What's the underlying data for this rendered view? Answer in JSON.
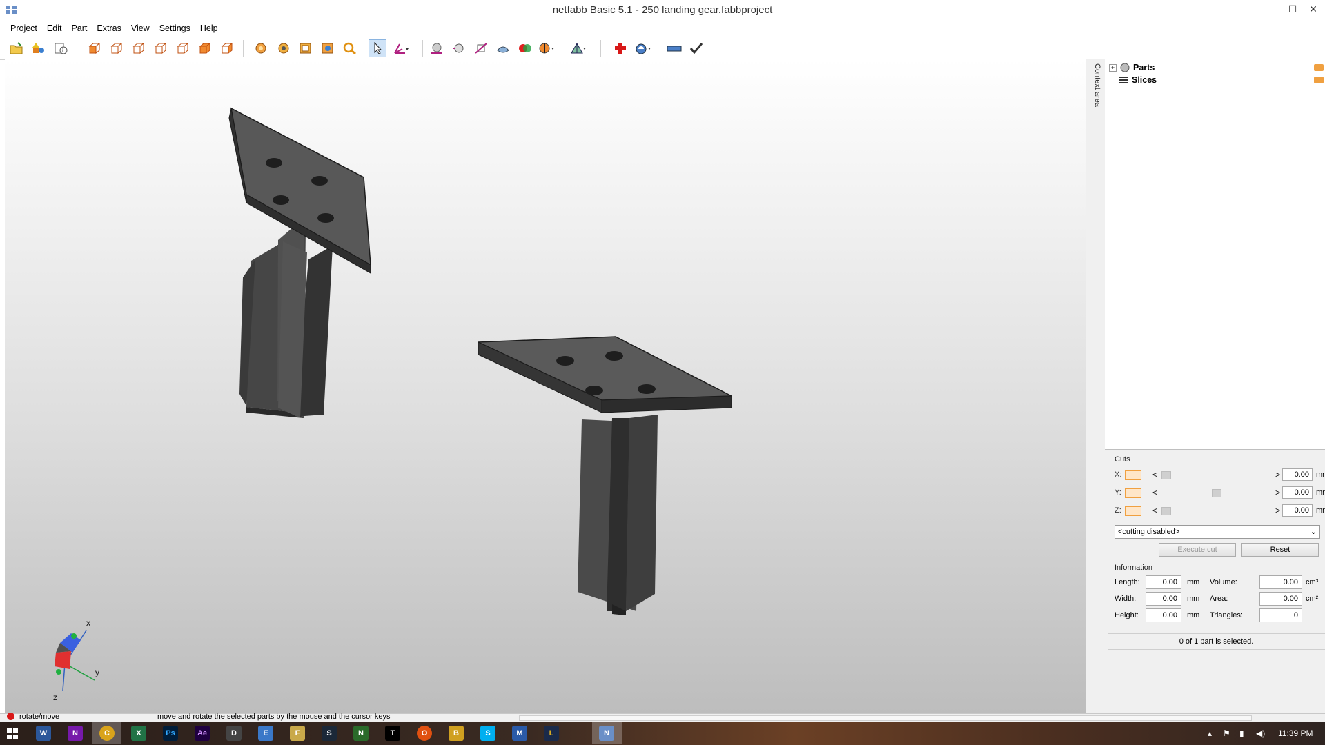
{
  "window": {
    "title": "netfabb Basic 5.1 - 250 landing gear.fabbproject",
    "minimize_label": "—",
    "maximize_label": "☐",
    "close_label": "✕"
  },
  "menu": {
    "items": [
      "Project",
      "Edit",
      "Part",
      "Extras",
      "View",
      "Settings",
      "Help"
    ]
  },
  "toolbar": {
    "icons": [
      "open-project-icon",
      "add-part-icon",
      "project-info-icon",
      "view-front-icon",
      "view-back-icon",
      "view-left-icon",
      "view-right-icon",
      "view-top-icon",
      "view-bottom-icon",
      "view-perspective-icon",
      "zoom-all-icon",
      "zoom-selection-icon",
      "zoom-window-icon",
      "zoom-shadow-icon",
      "zoom-icon",
      "select-pointer-icon",
      "rotate-move-icon",
      "render-mode-icon",
      "light-icon",
      "measure-icon",
      "shading-icon",
      "colors-icon",
      "section-icon",
      "mesh-icon",
      "repair-icon",
      "analysis-icon",
      "ruler-icon",
      "check-icon"
    ]
  },
  "viewport": {
    "axes": {
      "x": "x",
      "y": "y",
      "z": "z"
    }
  },
  "context_tab": {
    "label": "Context area"
  },
  "tree": {
    "parts": "Parts",
    "slices": "Slices",
    "expander": "+"
  },
  "cuts": {
    "label": "Cuts",
    "rows": [
      {
        "axis": "X:",
        "value": "0.00",
        "unit": "mm",
        "thumb_fraction": 0.0
      },
      {
        "axis": "Y:",
        "value": "0.00",
        "unit": "mm",
        "thumb_fraction": 0.5
      },
      {
        "axis": "Z:",
        "value": "0.00",
        "unit": "mm",
        "thumb_fraction": 0.0
      }
    ],
    "arrow_left": "<",
    "arrow_right": ">",
    "mode": "<cutting disabled>",
    "execute": "Execute cut",
    "reset": "Reset"
  },
  "information": {
    "label": "Information",
    "length_label": "Length:",
    "length": "0.00",
    "width_label": "Width:",
    "width": "0.00",
    "height_label": "Height:",
    "height": "0.00",
    "mm": "mm",
    "volume_label": "Volume:",
    "volume": "0.00",
    "area_label": "Area:",
    "area": "0.00",
    "triangles_label": "Triangles:",
    "triangles": "0",
    "cm3": "cm³",
    "cm2": "cm²"
  },
  "selection_status": "0 of 1 part is selected.",
  "statusbar": {
    "mode": "rotate/move",
    "hint": "move and rotate the selected parts by the mouse and the cursor keys"
  },
  "taskbar": {
    "clock": "11:39 PM",
    "apps": [
      "W",
      "N",
      "C",
      "X",
      "Ps",
      "Ae",
      "D",
      "E",
      "F",
      "S",
      "N",
      "T",
      "O",
      "B",
      "S",
      "M",
      "L",
      "N"
    ]
  },
  "colors": {
    "accent": "#3b7fd8",
    "part_top": "#5a5a5a",
    "part_side": "#3c3c3c"
  }
}
